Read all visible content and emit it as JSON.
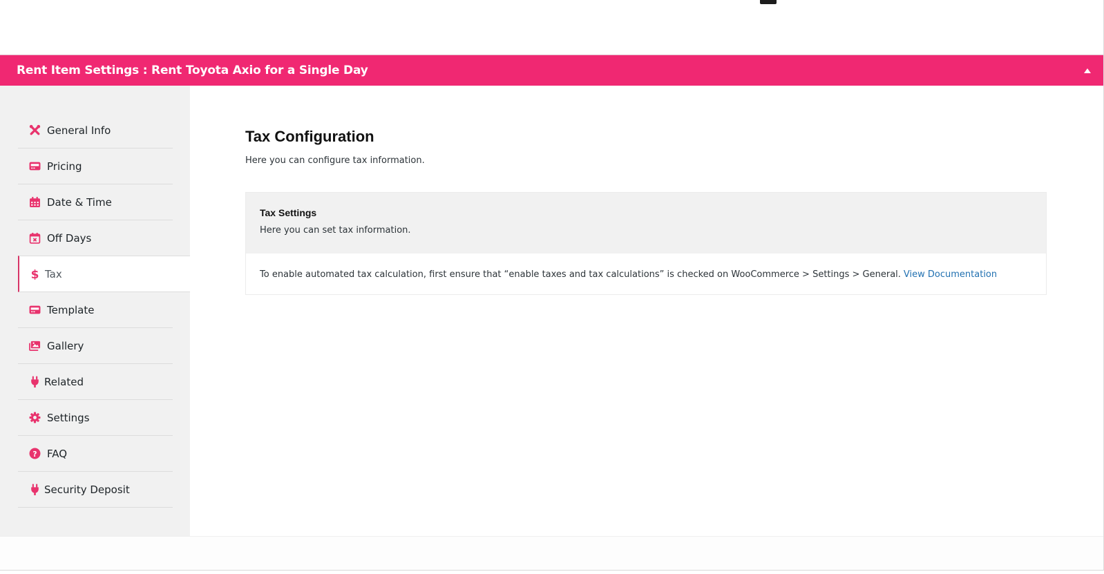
{
  "panel": {
    "title": "Rent Item Settings : Rent Toyota Axio for a Single Day",
    "toggle_icon": "triangle-up-icon"
  },
  "colors": {
    "accent": "#f02872",
    "icon": "#e8336d",
    "link": "#2271b1",
    "sidebar_bg": "#f1f1f1"
  },
  "sidebar": {
    "items": [
      {
        "label": "General Info",
        "icon": "tools-icon",
        "active": false
      },
      {
        "label": "Pricing",
        "icon": "card-icon",
        "active": false
      },
      {
        "label": "Date & Time",
        "icon": "calendar-icon",
        "active": false
      },
      {
        "label": "Off Days",
        "icon": "calendar-x-icon",
        "active": false
      },
      {
        "label": "Tax",
        "icon": "dollar-icon",
        "active": true
      },
      {
        "label": "Template",
        "icon": "card-icon",
        "active": false
      },
      {
        "label": "Gallery",
        "icon": "images-icon",
        "active": false
      },
      {
        "label": "Related",
        "icon": "plug-icon",
        "active": false
      },
      {
        "label": "Settings",
        "icon": "gear-icon",
        "active": false
      },
      {
        "label": "FAQ",
        "icon": "question-circle-icon",
        "active": false
      },
      {
        "label": "Security Deposit",
        "icon": "plug-icon",
        "active": false
      }
    ]
  },
  "main": {
    "title": "Tax Configuration",
    "description": "Here you can configure tax information.",
    "tax_settings": {
      "title": "Tax Settings",
      "subtitle": "Here you can set tax information.",
      "notice": "To enable automated tax calculation, first ensure that “enable taxes and tax calculations” is checked on WooCommerce > Settings > General.",
      "link_label": "View Documentation"
    }
  }
}
